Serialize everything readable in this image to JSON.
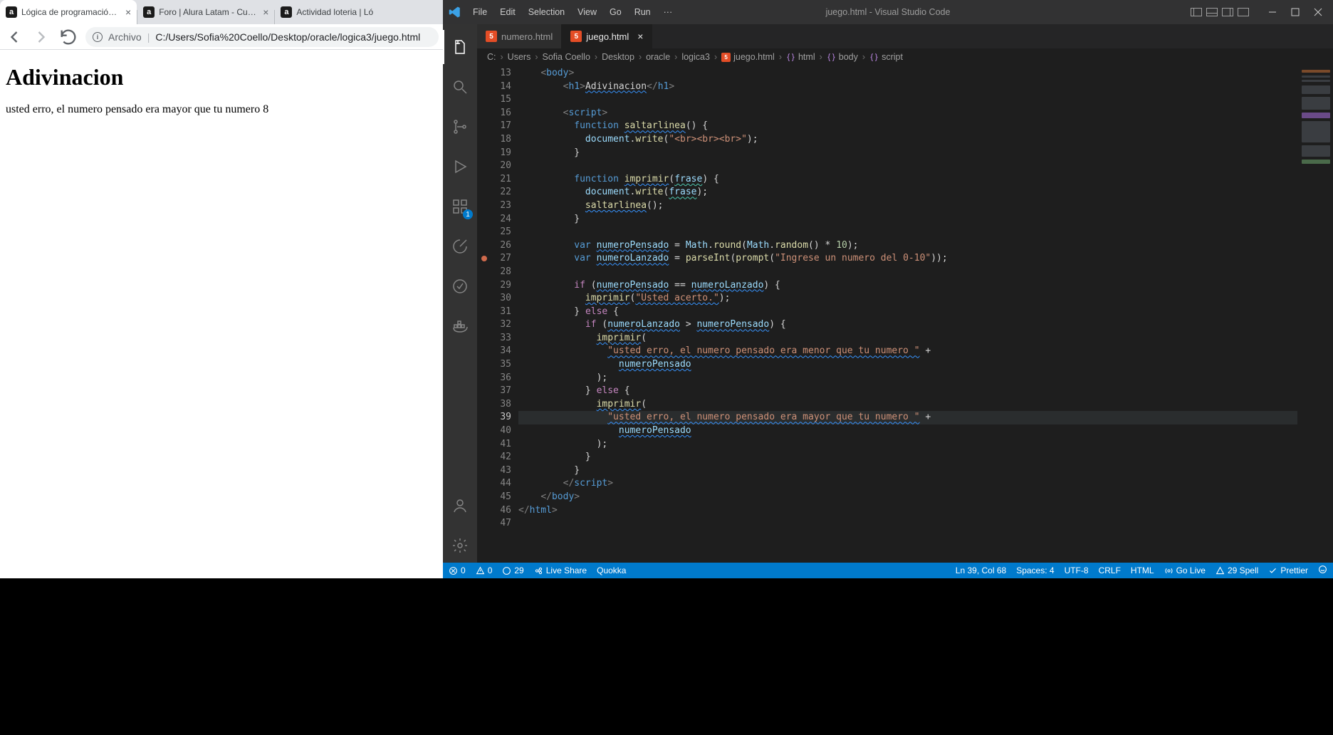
{
  "browser": {
    "tabs": [
      {
        "title": "Lógica de programación: Concep"
      },
      {
        "title": "Foro | Alura Latam - Cursos onlin"
      },
      {
        "title": "Actividad loteria | Ló"
      }
    ],
    "omni_prefix": "Archivo",
    "omni_url": "C:/Users/Sofia%20Coello/Desktop/oracle/logica3/juego.html",
    "page_heading": "Adivinacion",
    "page_text": "usted erro, el numero pensado era mayor que tu numero 8"
  },
  "vscode": {
    "title": "juego.html - Visual Studio Code",
    "menus": [
      "File",
      "Edit",
      "Selection",
      "View",
      "Go",
      "Run",
      "···"
    ],
    "tabs": [
      {
        "label": "numero.html"
      },
      {
        "label": "juego.html"
      }
    ],
    "breadcrumb": [
      "C:",
      "Users",
      "Sofia Coello",
      "Desktop",
      "oracle",
      "logica3",
      "juego.html",
      "html",
      "body",
      "script"
    ],
    "extensions_badge": "1",
    "line_numbers": [
      13,
      14,
      15,
      16,
      17,
      18,
      19,
      20,
      21,
      22,
      23,
      24,
      25,
      26,
      27,
      28,
      29,
      30,
      31,
      32,
      33,
      34,
      35,
      36,
      37,
      38,
      39,
      40,
      41,
      42,
      43,
      44,
      45,
      46,
      47
    ],
    "current_line": 39,
    "modified_line": 27,
    "status": {
      "errors": "0",
      "warnings": "0",
      "info": "29",
      "live_share": "Live Share",
      "quokka": "Quokka",
      "cursor": "Ln 39, Col 68",
      "spaces": "Spaces: 4",
      "encoding": "UTF-8",
      "eol": "CRLF",
      "lang": "HTML",
      "go_live": "Go Live",
      "spell": "29 Spell",
      "prettier": "Prettier"
    },
    "code": {
      "l13": "<body>",
      "l14_open": "<",
      "l14_tag": "h1",
      "l14_txt": "Adivinacion",
      "l14_close": "h1",
      "l16_tag": "script",
      "l17_fn": "saltarlinea",
      "l18_obj": "document",
      "l18_m": "write",
      "l18_s": "\"<br><br><br>\"",
      "l21_fn": "imprimir",
      "l21_p": "frase",
      "l22_obj": "document",
      "l22_m": "write",
      "l22_arg": "frase",
      "l23_fn": "saltarlinea",
      "l26_var": "numeroPensado",
      "l26_math": "Math",
      "l26_r": "round",
      "l26_rnd": "random",
      "l26_ten": "10",
      "l27_var": "numeroLanzado",
      "l27_pi": "parseInt",
      "l27_pr": "prompt",
      "l27_s": "\"Ingrese un numero del 0-10\"",
      "l29_a": "numeroPensado",
      "l29_b": "numeroLanzado",
      "l30_fn": "imprimir",
      "l30_s": "\"Usted acerto.\"",
      "l32_a": "numeroLanzado",
      "l32_b": "numeroPensado",
      "l33_fn": "imprimir",
      "l34_s": "\"usted erro, el numero pensado era menor que tu numero \"",
      "l35_v": "numeroPensado",
      "l38_fn": "imprimir",
      "l39_s": "\"usted erro, el numero pensado era mayor que tu numero \"",
      "l40_v": "numeroPensado",
      "l44_tag": "script",
      "l45_tag": "body",
      "l46_tag": "html"
    }
  }
}
